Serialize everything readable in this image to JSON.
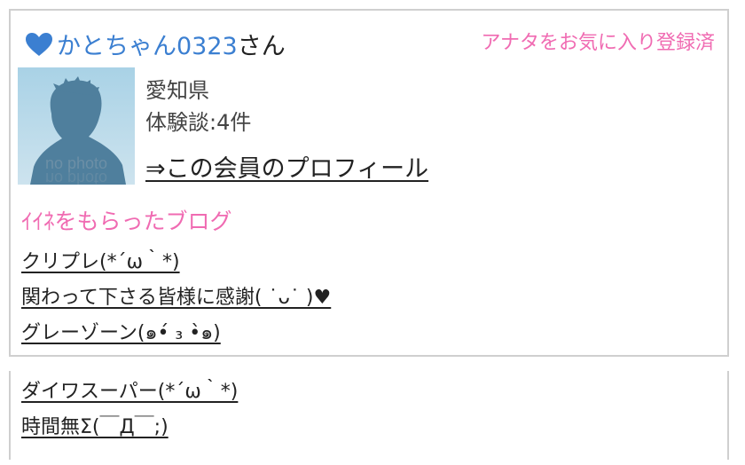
{
  "member": {
    "name": "かとちゃん0323",
    "honorific": "さん",
    "favorite_status": "アナタをお気に入り登録済",
    "avatar_text": "no photo",
    "prefecture": "愛知県",
    "experience_count": "体験談:4件",
    "profile_link": "⇒この会員のプロフィール"
  },
  "liked_blogs": {
    "title": "ｲｲﾈをもらったブログ",
    "items": [
      "クリプレ(*´ω｀*)",
      "関わって下さる皆様に感謝( ˙ᴗ˙ )♥",
      "グレーゾーン(๑•́ ₃ •̀๑)",
      "ダイワスーパー(*´ω｀*)",
      "時間無Σ(￣Д￣;)"
    ]
  },
  "colors": {
    "accent_blue": "#3b7fd1",
    "accent_pink": "#f06bb2",
    "border": "#cfcfcf"
  },
  "icons": {
    "heart": "heart-icon",
    "avatar": "no-photo-silhouette"
  }
}
